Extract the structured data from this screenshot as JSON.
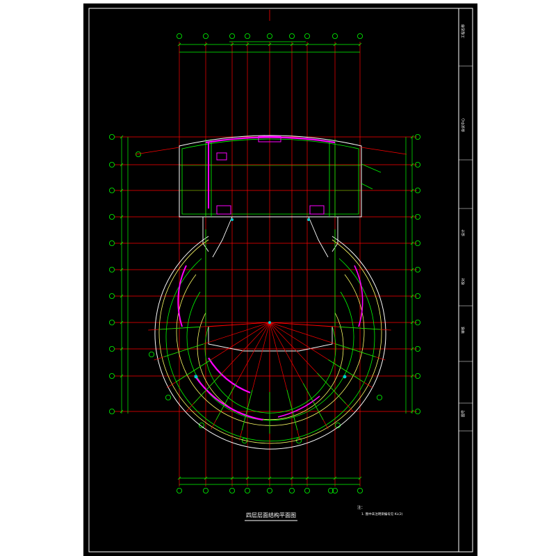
{
  "drawing": {
    "title": "四层层面结构平面图",
    "notes_header": "注：",
    "notes": [
      "1. 图中未注明梁编号见 KL(2)"
    ],
    "title_block": [
      "工程名称",
      "会议中心",
      "设计",
      "校对",
      "审核",
      "图号"
    ]
  },
  "colors": {
    "background": "#000000",
    "frame": "#ffffff",
    "grid_axis": "#ff0000",
    "walls": "#00ff00",
    "beams": "#ffff66",
    "rebar": "#ff00ff",
    "dimension": "#00ff00",
    "marker": "#00cccc"
  }
}
